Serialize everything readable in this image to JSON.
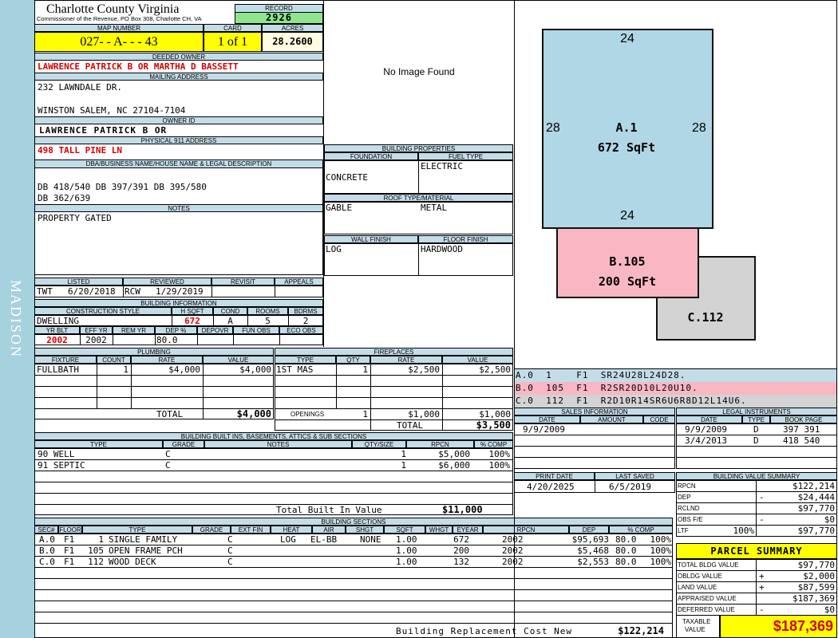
{
  "county": {
    "name": "Charlotte County Virginia",
    "sub": "Commissioner of the Revenue, PO Box 308, Charlotte CH, VA"
  },
  "side_label": "MADISON",
  "record": {
    "label": "RECORD",
    "value": "2926"
  },
  "map": {
    "label": "MAP NUMBER",
    "value": "027- - A- - - 43",
    "card_label": "CARD",
    "card": "1 of 1",
    "acres_label": "ACRES",
    "acres": "28.2600"
  },
  "owner": {
    "deeded_label": "DEEDED OWNER",
    "deeded": "LAWRENCE PATRICK B OR MARTHA D BASSETT",
    "mailing_label": "MAILING ADDRESS",
    "addr1": "232 LAWNDALE DR.",
    "addr2": "WINSTON SALEM, NC 27104-7104",
    "id_label": "OWNER ID",
    "id": "LAWRENCE PATRICK B OR",
    "physical_label": "PHYSICAL 911 ADDRESS",
    "physical": "498 TALL PINE LN"
  },
  "legal": {
    "label": "DBA/BUSINESS NAME/HOUSE NAME & LEGAL DESCRIPTION",
    "line1": "DB 418/540 DB 397/391 DB 395/580",
    "line2": "DB 362/639"
  },
  "notes": {
    "label": "NOTES",
    "text": "PROPERTY GATED"
  },
  "image_text": "No Image Found",
  "building_props": {
    "title": "BUILDING PROPERTIES",
    "foundation_label": "FOUNDATION",
    "foundation": "CONCRETE",
    "fuel_label": "FUEL TYPE",
    "fuel": "ELECTRIC",
    "roof_label": "ROOF TYPE/MATERIAL",
    "roof_type": "GABLE",
    "roof_material": "METAL",
    "wall_label": "WALL FINISH",
    "wall": "LOG",
    "floor_label": "FLOOR FINISH",
    "floor": "HARDWOOD"
  },
  "listing": {
    "listed_label": "LISTED",
    "listed_by": "TWT",
    "listed_date": "6/20/2018",
    "reviewed_label": "REVIEWED",
    "reviewed_by": "RCW",
    "reviewed_date": "1/29/2019",
    "revisit_label": "REVISIT",
    "appeals_label": "APPEALS"
  },
  "building_info": {
    "title": "BUILDING INFORMATION",
    "style_label": "CONSTRUCTION STYLE",
    "style": "DWELLING",
    "hsqft_label": "H SQFT",
    "hsqft": "672",
    "cond_label": "COND",
    "cond": "A",
    "rooms_label": "ROOMS",
    "rooms": "5",
    "bdrms_label": "BDRMS",
    "bdrms": "2",
    "yrblt_label": "YR BLT",
    "yrblt": "2002",
    "effyr_label": "EFF YR",
    "effyr": "2002",
    "remyr_label": "REM YR",
    "dep_label": "DEP %",
    "dep": "80.0",
    "depovr_label": "DEPOVR",
    "funobs_label": "FUN OBS",
    "ecoobs_label": "ECO OBS"
  },
  "plumbing": {
    "title": "PLUMBING",
    "headers": [
      "FIXTURE",
      "COUNT",
      "RATE",
      "VALUE"
    ],
    "rows": [
      {
        "fixture": "FULLBATH",
        "count": "1",
        "rate": "$4,000",
        "value": "$4,000"
      }
    ],
    "total_label": "TOTAL",
    "total": "$4,000"
  },
  "fireplaces": {
    "title": "FIREPLACES",
    "headers": [
      "TYPE",
      "QTY",
      "RATE",
      "VALUE"
    ],
    "rows": [
      {
        "type": "1ST MAS",
        "qty": "1",
        "rate": "$2,500",
        "value": "$2,500"
      }
    ],
    "openings_label": "OPENINGS",
    "openings_qty": "1",
    "openings_rate": "$1,000",
    "openings_value": "$1,000",
    "total_label": "TOTAL",
    "total": "$3,500"
  },
  "builtins": {
    "title": "BUILDING BUILT INS, BASEMENTS, ATTICS & SUB SECTIONS",
    "headers": [
      "TYPE",
      "GRADE",
      "NOTES",
      "QTY/SIZE",
      "RPCN",
      "% COMP"
    ],
    "rows": [
      {
        "type": "90 WELL",
        "grade": "C",
        "notes": "",
        "qty": "1",
        "rpcn": "$5,000",
        "comp": "100%"
      },
      {
        "type": "91 SEPTIC",
        "grade": "C",
        "notes": "",
        "qty": "1",
        "rpcn": "$6,000",
        "comp": "100%"
      }
    ],
    "total_label": "Total Built In Value",
    "total": "$11,000"
  },
  "sketch": {
    "a_top": "24",
    "a_left": "28",
    "a_right": "28",
    "a_bottom": "24",
    "a_label": "A.1",
    "a_area": "672 SqFt",
    "b_label": "B.105",
    "b_area": "200 SqFt",
    "c_label": "C.112",
    "codes": [
      "A.0  1    F1  SR24U28L24D28.",
      "B.0  105  F1  R2SR20D10L20U10.",
      "C.0  112  F1  R2D10R14SR6U6R8D12L14U6."
    ],
    "color_a": "#b0d7e5",
    "color_b": "#f8b7c3",
    "color_c": "#d3d3d3"
  },
  "sales": {
    "title": "SALES INFORMATION",
    "headers": [
      "DATE",
      "AMOUNT",
      "CODE"
    ],
    "rows": [
      {
        "date": "9/9/2009",
        "amount": "",
        "code": ""
      }
    ]
  },
  "legal_instruments": {
    "title": "LEGAL INSTRUMENTS",
    "headers": [
      "DATE",
      "TYPE",
      "BOOK PAGE"
    ],
    "rows": [
      {
        "date": "9/9/2009",
        "type": "D",
        "book": "397 391"
      },
      {
        "date": "3/4/2013",
        "type": "D",
        "book": "418 540"
      }
    ]
  },
  "print": {
    "print_label": "PRINT DATE",
    "print_date": "4/20/2025",
    "saved_label": "LAST SAVED",
    "saved_date": "6/5/2019"
  },
  "value_summary": {
    "title": "BUILDING VALUE SUMMARY",
    "rows": [
      {
        "label": "RPCN",
        "sign": "",
        "value": "$122,214"
      },
      {
        "label": "DEP",
        "sign": "-",
        "value": "$24,444"
      },
      {
        "label": "RCLND",
        "sign": "",
        "value": "$97,770"
      },
      {
        "label": "OBS F/E",
        "sign": "-",
        "value": "$0"
      },
      {
        "label": "LTF",
        "pct": "100%",
        "sign": "",
        "value": "$97,770"
      }
    ]
  },
  "parcel": {
    "title": "PARCEL SUMMARY",
    "rows": [
      {
        "label": "TOTAL BLDG VALUE",
        "sign": "",
        "value": "$97,770"
      },
      {
        "label": "OBLDG VALUE",
        "sign": "+",
        "value": "$2,000"
      },
      {
        "label": "LAND VALUE",
        "sign": "+",
        "value": "$87,599"
      },
      {
        "label": "APPRAISED VALUE",
        "sign": "",
        "value": "$187,369"
      },
      {
        "label": "DEFERRED VALUE",
        "sign": "-",
        "value": "$0"
      }
    ],
    "taxable_label1": "TAXABLE",
    "taxable_label2": "VALUE",
    "taxable": "$187,369"
  },
  "sections": {
    "title": "BUILDING SECTIONS",
    "headers": [
      "SEC#",
      "FLOOR",
      "TYPE",
      "GRADE",
      "EXT FIN",
      "HEAT",
      "AIR",
      "SHGT",
      "SQFT",
      "WHGT",
      "EYEAR",
      "RPCN",
      "DEP",
      "% COMP"
    ],
    "rows": [
      {
        "sec": "A.0",
        "floor": "F1",
        "code": "1",
        "type": "SINGLE FAMILY",
        "grade": "C",
        "ext": "LOG",
        "heat": "EL-BB",
        "air": "NONE",
        "shgt": "1.00",
        "sqft": "672",
        "whgt": "",
        "eyear": "2002",
        "rpcn": "$95,693",
        "dep": "80.0",
        "comp": "100%"
      },
      {
        "sec": "B.0",
        "floor": "F1",
        "code": "105",
        "type": "OPEN FRAME PCH",
        "grade": "C",
        "ext": "",
        "heat": "",
        "air": "",
        "shgt": "1.00",
        "sqft": "200",
        "whgt": "",
        "eyear": "2002",
        "rpcn": "$5,468",
        "dep": "80.0",
        "comp": "100%"
      },
      {
        "sec": "C.0",
        "floor": "F1",
        "code": "112",
        "type": "WOOD DECK",
        "grade": "C",
        "ext": "",
        "heat": "",
        "air": "",
        "shgt": "1.00",
        "sqft": "132",
        "whgt": "",
        "eyear": "2002",
        "rpcn": "$2,553",
        "dep": "80.0",
        "comp": "100%"
      }
    ],
    "replacement_label": "Building Replacement Cost New",
    "replacement": "$122,214"
  },
  "colors": {
    "header_bg": "#c3dde8",
    "side_bar": "#a6d1df",
    "record_bg": "#8ee58e",
    "map_bg": "#ffff00",
    "acres_bg": "#fffbe0",
    "accent_red": "#d40000"
  }
}
